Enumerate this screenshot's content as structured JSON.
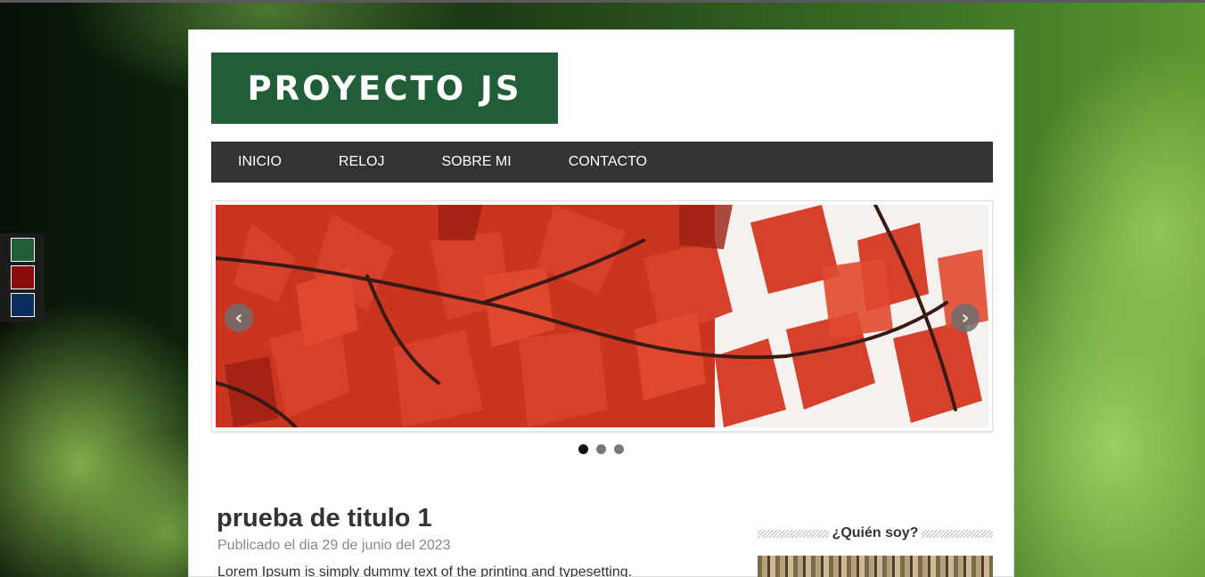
{
  "colors": {
    "brand": "#215e37",
    "nav_bg": "#333333",
    "swatches": [
      "#215e37",
      "#8b0a0a",
      "#0a2f5e"
    ]
  },
  "header": {
    "logo": "PROYECTO JS"
  },
  "nav": {
    "items": [
      "INICIO",
      "RELOJ",
      "SOBRE MI",
      "CONTACTO"
    ]
  },
  "slider": {
    "prev_icon": "chevron-left-icon",
    "next_icon": "chevron-right-icon",
    "slide_count": 3,
    "active_index": 0
  },
  "post": {
    "title": "prueba de titulo 1",
    "meta": "Publicado el dia 29 de junio del 2023",
    "body": "Lorem Ipsum is simply dummy text of the printing and typesetting."
  },
  "sidebar": {
    "widget_title": "¿Quién soy?"
  }
}
